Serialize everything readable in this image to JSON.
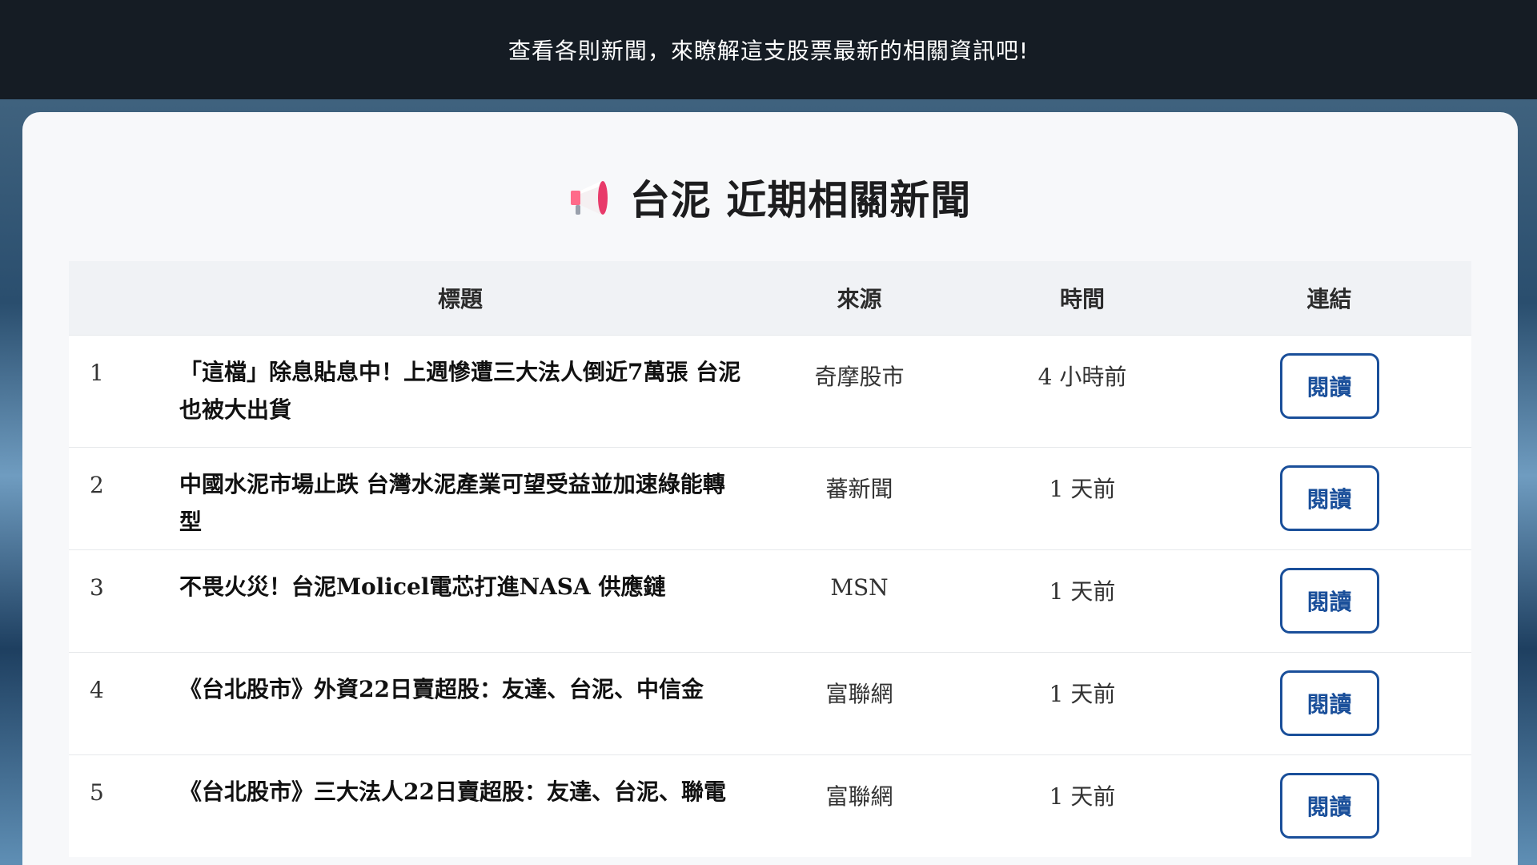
{
  "banner": {
    "text": "查看各則新聞，來瞭解這支股票最新的相關資訊吧!"
  },
  "card": {
    "icon": "megaphone-icon",
    "title": "台泥 近期相關新聞"
  },
  "table": {
    "headers": {
      "index": "",
      "title": "標題",
      "source": "來源",
      "time": "時間",
      "link": "連結"
    },
    "rows": [
      {
        "index": "1",
        "title": "「這檔」除息貼息中！上週慘遭三大法人倒近7萬張 台泥也被大出貨",
        "source": "奇摩股市",
        "time": "4 小時前",
        "link_label": "閱讀"
      },
      {
        "index": "2",
        "title": "中國水泥市場止跌 台灣水泥產業可望受益並加速綠能轉型",
        "source": "蕃新聞",
        "time": "1 天前",
        "link_label": "閱讀"
      },
      {
        "index": "3",
        "title": "不畏火災！台泥Molicel電芯打進NASA 供應鏈",
        "source": "MSN",
        "time": "1 天前",
        "link_label": "閱讀"
      },
      {
        "index": "4",
        "title": "《台北股市》外資22日賣超股：友達、台泥、中信金",
        "source": "富聯網",
        "time": "1 天前",
        "link_label": "閱讀"
      },
      {
        "index": "5",
        "title": "《台北股市》三大法人22日賣超股：友達、台泥、聯電",
        "source": "富聯網",
        "time": "1 天前",
        "link_label": "閱讀"
      }
    ]
  },
  "colors": {
    "banner_bg": "#151c24",
    "card_bg": "#f7f8fa",
    "accent": "#1a4f9a"
  }
}
